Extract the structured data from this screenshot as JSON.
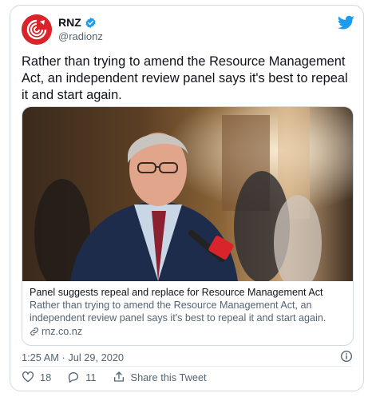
{
  "author": {
    "display_name": "RNZ",
    "handle": "@radionz",
    "avatar_icon": "rnz-logo-icon",
    "verified_icon": "verified-badge-icon"
  },
  "brand_icon": "twitter-bird-icon",
  "tweet": {
    "text": "Rather than trying to amend the Resource Management Act, an independent review panel says it's best to repeal it and start again."
  },
  "link_card": {
    "image_alt_icon": "news-photo",
    "title": "Panel suggests repeal and replace for Resource Management Act",
    "description": "Rather than trying to amend the Resource Management Act, an independent review panel says it's best to repeal it and start again.",
    "domain": "rnz.co.nz",
    "domain_icon": "link-icon"
  },
  "meta": {
    "timestamp": "1:25 AM · Jul 29, 2020",
    "info_icon": "info-icon"
  },
  "actions": {
    "likes": "18",
    "replies": "11",
    "share_label": "Share this Tweet"
  },
  "colors": {
    "brand_red": "#d8242a",
    "twitter_blue": "#1d9bf0",
    "text_primary": "#0f1419",
    "text_secondary": "#536471",
    "border": "#cfd9de"
  }
}
